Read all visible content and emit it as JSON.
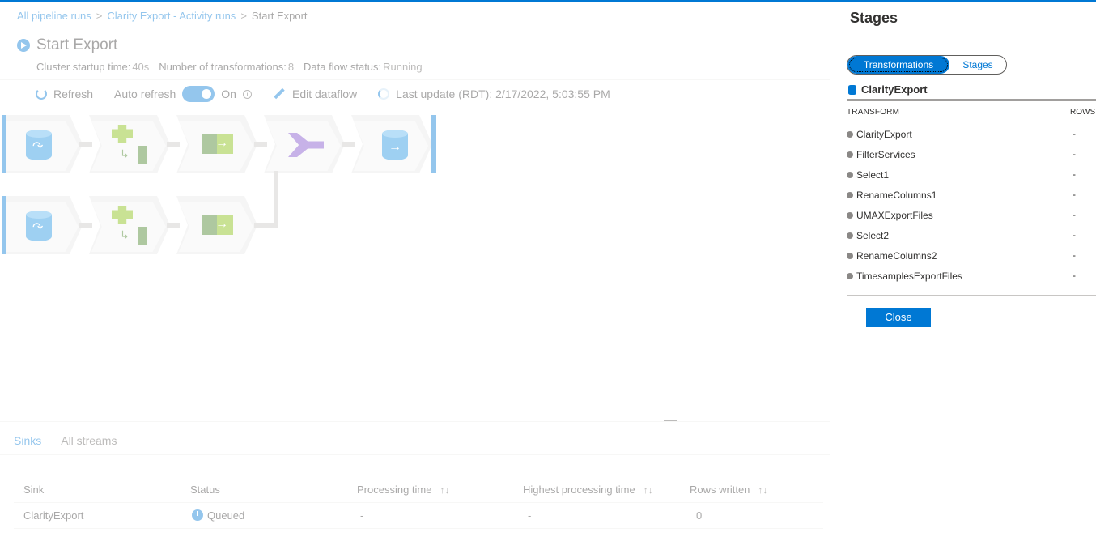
{
  "breadcrumb": {
    "items": [
      "All pipeline runs",
      "Clarity Export - Activity runs",
      "Start Export"
    ],
    "separator": ">"
  },
  "page": {
    "title": "Start Export",
    "meta": [
      {
        "label": "Cluster startup time:",
        "value": "40s"
      },
      {
        "label": "Number of transformations:",
        "value": "8"
      },
      {
        "label": "Data flow status:",
        "value": "Running"
      }
    ]
  },
  "toolbar": {
    "refresh_label": "Refresh",
    "auto_refresh_label": "Auto refresh",
    "toggle_state": "On",
    "edit_label": "Edit dataflow",
    "last_update": "Last update (RDT): 2/17/2022, 5:03:55 PM"
  },
  "flow": {
    "row1": [
      "source-icon",
      "filter-icon",
      "select-icon",
      "union-icon",
      "sink-icon"
    ],
    "row2": [
      "source-icon",
      "filter-icon",
      "select-icon"
    ]
  },
  "bottom": {
    "tabs": [
      "Sinks",
      "All streams"
    ],
    "columns": [
      "Sink",
      "Status",
      "Processing time",
      "Highest processing time",
      "Rows written"
    ],
    "rows": [
      {
        "sink": "ClarityExport",
        "status": "Queued",
        "processing": "-",
        "highest": "-",
        "rows": "0"
      }
    ]
  },
  "panel": {
    "title": "Stages",
    "pivot": [
      "Transformations",
      "Stages"
    ],
    "source": "ClarityExport",
    "col_transform": "TRANSFORM",
    "col_rows": "ROWS",
    "transforms": [
      {
        "name": "ClarityExport",
        "rows": "-"
      },
      {
        "name": "FilterServices",
        "rows": "-"
      },
      {
        "name": "Select1",
        "rows": "-"
      },
      {
        "name": "RenameColumns1",
        "rows": "-"
      },
      {
        "name": "UMAXExportFiles",
        "rows": "-"
      },
      {
        "name": "Select2",
        "rows": "-"
      },
      {
        "name": "RenameColumns2",
        "rows": "-"
      },
      {
        "name": "TimesamplesExportFiles",
        "rows": "-"
      }
    ],
    "close_label": "Close"
  },
  "colors": {
    "accent": "#0078d4",
    "filter_green": "#7fba00",
    "union_purple": "#7a48c8"
  }
}
